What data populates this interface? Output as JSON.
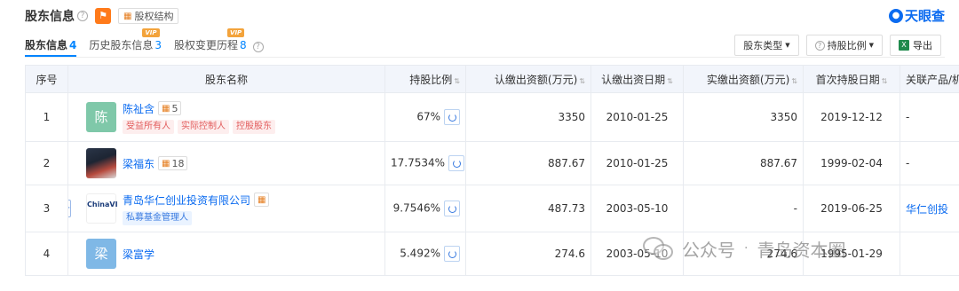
{
  "header": {
    "title": "股东信息",
    "help": "?",
    "equity_btn": "股权结构",
    "brand": "天眼查"
  },
  "tabs": [
    {
      "label": "股东信息",
      "count": "4"
    },
    {
      "label": "历史股东信息",
      "count": "3",
      "vip": "VIP"
    },
    {
      "label": "股权变更历程",
      "count": "8",
      "vip": "VIP"
    }
  ],
  "tools": {
    "type_label": "股东类型",
    "ratio_label": "持股比例",
    "export_label": "导出"
  },
  "columns": [
    "序号",
    "股东名称",
    "持股比例",
    "认缴出资额(万元)",
    "认缴出资日期",
    "实缴出资额(万元)",
    "首次持股日期",
    "关联产品/机构"
  ],
  "rows": [
    {
      "idx": "1",
      "avatar": "陈",
      "name": "陈祉含",
      "rel": "5",
      "tags": [
        "受益所有人",
        "实际控制人",
        "控股股东"
      ],
      "ratio": "67%",
      "sub_amount": "3350",
      "sub_date": "2010-01-25",
      "paid_amount": "3350",
      "first_date": "2019-12-12",
      "related": "-"
    },
    {
      "idx": "2",
      "avatar": "",
      "name": "梁福东",
      "rel": "18",
      "tags": [],
      "ratio": "17.7534%",
      "sub_amount": "887.67",
      "sub_date": "2010-01-25",
      "paid_amount": "887.67",
      "first_date": "1999-02-04",
      "related": "-"
    },
    {
      "idx": "3",
      "avatar": "ChinaVI",
      "name": "青岛华仁创业投资有限公司",
      "rel": "",
      "tags": [
        "私募基金管理人"
      ],
      "ratio": "9.7546%",
      "sub_amount": "487.73",
      "sub_date": "2003-05-10",
      "paid_amount": "-",
      "first_date": "2019-06-25",
      "related": "华仁创投"
    },
    {
      "idx": "4",
      "avatar": "梁",
      "name": "梁富学",
      "rel": "",
      "tags": [],
      "ratio": "5.492%",
      "sub_amount": "274.6",
      "sub_date": "2003-05-10",
      "paid_amount": "274.6",
      "first_date": "1995-01-29",
      "related": ""
    }
  ],
  "watermark": {
    "a": "公众号",
    "b": "青岛资本圈"
  }
}
